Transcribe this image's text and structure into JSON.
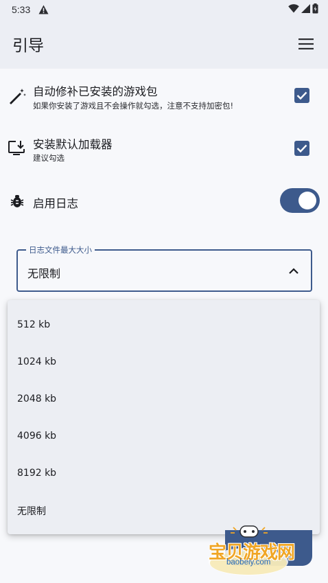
{
  "status_bar": {
    "time": "5:33",
    "left_icons": [
      "warning-icon"
    ],
    "right_icons": [
      "wifi-icon",
      "signal-icon",
      "battery-icon"
    ]
  },
  "app_bar": {
    "title": "引导",
    "menu_icon": "hamburger-menu-icon"
  },
  "settings": {
    "auto_patch": {
      "icon": "magic-wand-icon",
      "title": "自动修补已安装的游戏包",
      "subtitle": "如果你安装了游戏且不会操作就勾选，注意不支持加密包!",
      "checked": true
    },
    "install_loader": {
      "icon": "install-device-icon",
      "title": "安装默认加载器",
      "subtitle": "建议勾选",
      "checked": true
    },
    "enable_log": {
      "icon": "bug-icon",
      "title": "启用日志",
      "enabled": true
    }
  },
  "log_size": {
    "label": "日志文件最大大小",
    "value": "无限制",
    "options": [
      "512 kb",
      "1024 kb",
      "2048 kb",
      "4096 kb",
      "8192 kb",
      "无限制"
    ]
  },
  "watermark": {
    "text": "宝贝游戏网",
    "url": "baobeiy.com"
  },
  "colors": {
    "accent": "#3d5a8c",
    "background": "#f7f8fb",
    "app_bar": "#eceef4"
  }
}
